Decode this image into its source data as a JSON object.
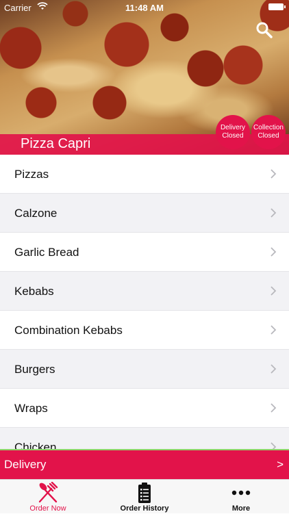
{
  "status_bar": {
    "carrier": "Carrier",
    "time": "11:48 AM"
  },
  "restaurant": {
    "name": "Pizza Capri"
  },
  "badges": {
    "delivery": {
      "line1": "Delivery",
      "line2": "Closed"
    },
    "collection": {
      "line1": "Collection",
      "line2": "Closed"
    }
  },
  "categories": [
    {
      "label": "Pizzas"
    },
    {
      "label": "Calzone"
    },
    {
      "label": "Garlic Bread"
    },
    {
      "label": "Kebabs"
    },
    {
      "label": "Combination Kebabs"
    },
    {
      "label": "Burgers"
    },
    {
      "label": "Wraps"
    },
    {
      "label": "Chicken"
    }
  ],
  "delivery_bar": {
    "label": "Delivery",
    "arrow": ">"
  },
  "tabs": [
    {
      "label": "Order Now",
      "icon": "fork-knife-icon",
      "active": true
    },
    {
      "label": "Order History",
      "icon": "clipboard-list-icon",
      "active": false
    },
    {
      "label": "More",
      "icon": "more-dots-icon",
      "active": false
    }
  ],
  "colors": {
    "accent": "#e2134a",
    "divider": "#8fd46a",
    "alt_row": "#f2f2f5"
  }
}
